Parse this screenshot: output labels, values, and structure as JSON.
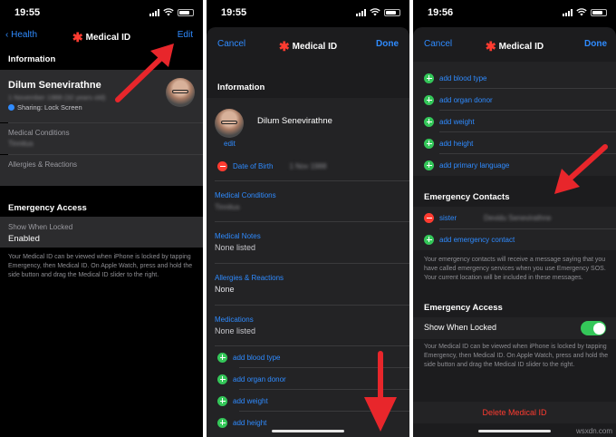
{
  "colors": {
    "accent_blue": "#2f8bff",
    "add_green": "#34c759",
    "delete_red": "#ff3b30",
    "arrow_red": "#e8262b"
  },
  "screen1": {
    "time": "19:55",
    "back_label": "Health",
    "title": "Medical ID",
    "edit_label": "Edit",
    "info_header": "Information",
    "name": "Dilum Senevirathne",
    "birth_blurred": "1 November 1988 (32 years old)",
    "sharing": "Sharing: Lock Screen",
    "conditions_label": "Medical Conditions",
    "conditions_value": "Tinnitus",
    "allergies_label": "Allergies & Reactions",
    "emergency_header": "Emergency Access",
    "show_locked_label": "Show When Locked",
    "show_locked_value": "Enabled",
    "note": "Your Medical ID can be viewed when iPhone is locked by tapping Emergency, then Medical ID. On Apple Watch, press and hold the side button and drag the Medical ID slider to the right."
  },
  "screen2": {
    "time": "19:55",
    "cancel_label": "Cancel",
    "title": "Medical ID",
    "done_label": "Done",
    "info_header": "Information",
    "name": "Dilum Senevirathne",
    "edit_photo": "edit",
    "dob_label": "Date of Birth",
    "dob_value": "1 Nov 1988",
    "conditions_label": "Medical Conditions",
    "conditions_value": "Tinnitus",
    "notes_label": "Medical Notes",
    "notes_value": "None listed",
    "allergies_label": "Allergies & Reactions",
    "allergies_value": "None",
    "medications_label": "Medications",
    "medications_value": "None listed",
    "add_items": [
      "add blood type",
      "add organ donor",
      "add weight",
      "add height"
    ]
  },
  "screen3": {
    "time": "19:56",
    "cancel_label": "Cancel",
    "title": "Medical ID",
    "done_label": "Done",
    "add_items": [
      "add blood type",
      "add organ donor",
      "add weight",
      "add height",
      "add primary language"
    ],
    "contacts_header": "Emergency Contacts",
    "contact_relation": "sister",
    "contact_name": "Devidu Senevirathne",
    "add_contact": "add emergency contact",
    "contacts_note": "Your emergency contacts will receive a message saying that you have called emergency services when you use Emergency SOS. Your current location will be included in these messages.",
    "emergency_header": "Emergency Access",
    "show_locked_label": "Show When Locked",
    "show_locked_on": true,
    "note": "Your Medical ID can be viewed when iPhone is locked by tapping Emergency, then Medical ID. On Apple Watch, press and hold the side button and drag the Medical ID slider to the right.",
    "delete_label": "Delete Medical ID"
  },
  "watermark": "wsxdn.com"
}
